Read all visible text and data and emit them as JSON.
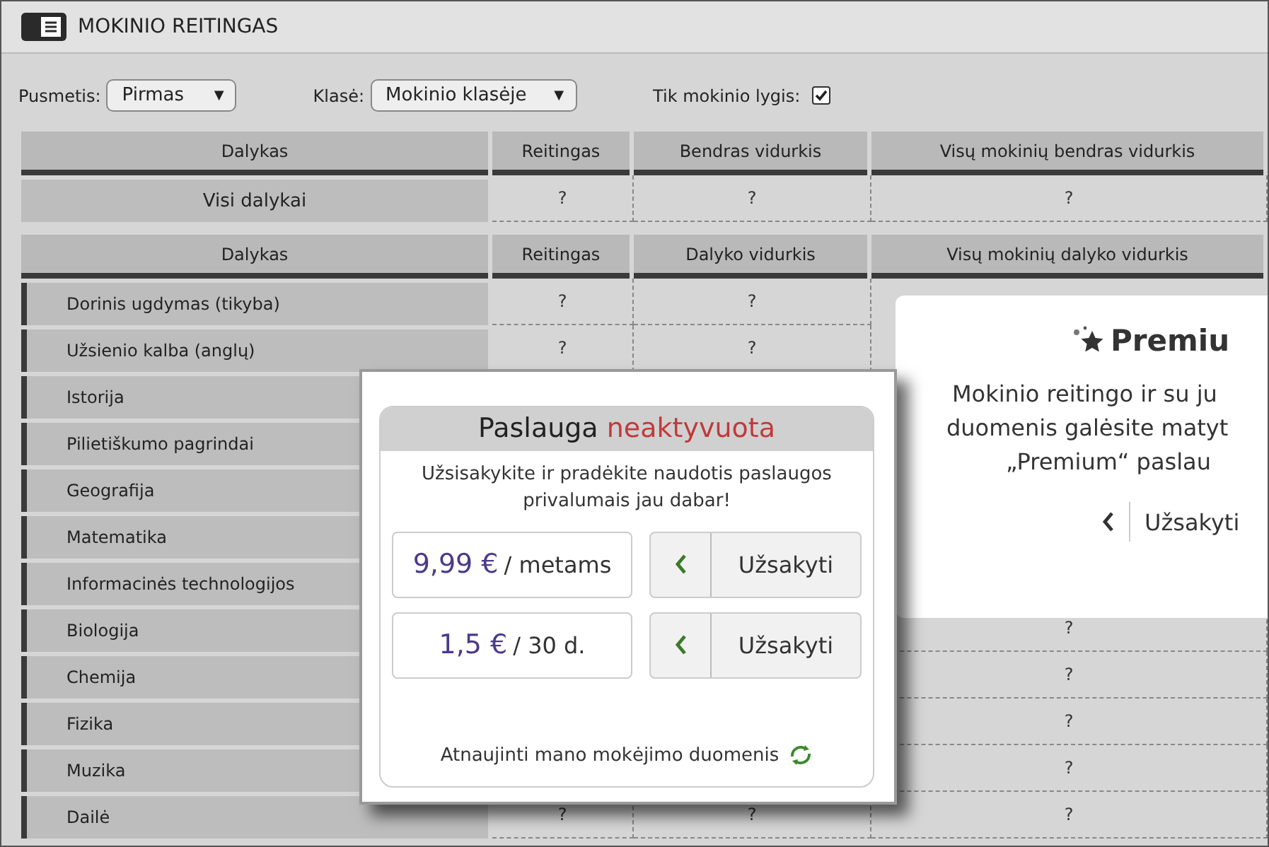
{
  "title": "MOKINIO REITINGAS",
  "filters": [
    {
      "label": "Pusmetis:",
      "value": "Pirmas",
      "arrow": "▼"
    },
    {
      "label": "Klasė:",
      "value": "Mokinio klasėje",
      "arrow": "▼"
    }
  ],
  "checkbox": {
    "label": "Tik mokinio lygis:",
    "checked": true
  },
  "summary_table": {
    "columns": [
      "Dalykas",
      "Reitingas",
      "Bendras vidurkis",
      "Visų mokinių bendras vidurkis"
    ],
    "rows": [
      {
        "subject": "Visi dalykai",
        "rating": "?",
        "average": "?",
        "all_average": "?"
      }
    ]
  },
  "subjects_table": {
    "columns": [
      "Dalykas",
      "Reitingas",
      "Dalyko vidurkis",
      "Visų mokinių dalyko vidurkis"
    ],
    "rows": [
      {
        "subject": "Dorinis ugdymas (tikyba)",
        "rating": "?",
        "average": "?"
      },
      {
        "subject": "Užsienio kalba (anglų)",
        "rating": "?",
        "average": "?"
      },
      {
        "subject": "Istorija"
      },
      {
        "subject": "Pilietiškumo pagrindai"
      },
      {
        "subject": "Geografija"
      },
      {
        "subject": "Matematika"
      },
      {
        "subject": "Informacinės technologijos"
      },
      {
        "subject": "Biologija",
        "all_average": "?"
      },
      {
        "subject": "Chemija",
        "all_average": "?"
      },
      {
        "subject": "Fizika",
        "all_average": "?"
      },
      {
        "subject": "Muzika",
        "all_average": "?"
      },
      {
        "subject": "Dailė",
        "rating": "?",
        "average": "?",
        "all_average": "?"
      }
    ]
  },
  "premium_card": {
    "title": "Premiu",
    "lines": [
      "Mokinio reitingo ir su ju",
      "duomenis galėsite matyt",
      "„Premium“ paslau"
    ],
    "button": "Užsakyti"
  },
  "popup": {
    "title": "Paslauga",
    "status": "neaktyvuota",
    "message": "Užsisakykite ir pradėkite naudotis paslaugos privalumais jau dabar!",
    "plans": [
      {
        "price": "9,99 €",
        "period": "/ metams",
        "button": "Užsakyti"
      },
      {
        "price": "1,5 €",
        "period": "/ 30 d.",
        "button": "Užsakyti"
      }
    ],
    "footer": "Atnaujinti mano mokėjimo duomenis"
  }
}
